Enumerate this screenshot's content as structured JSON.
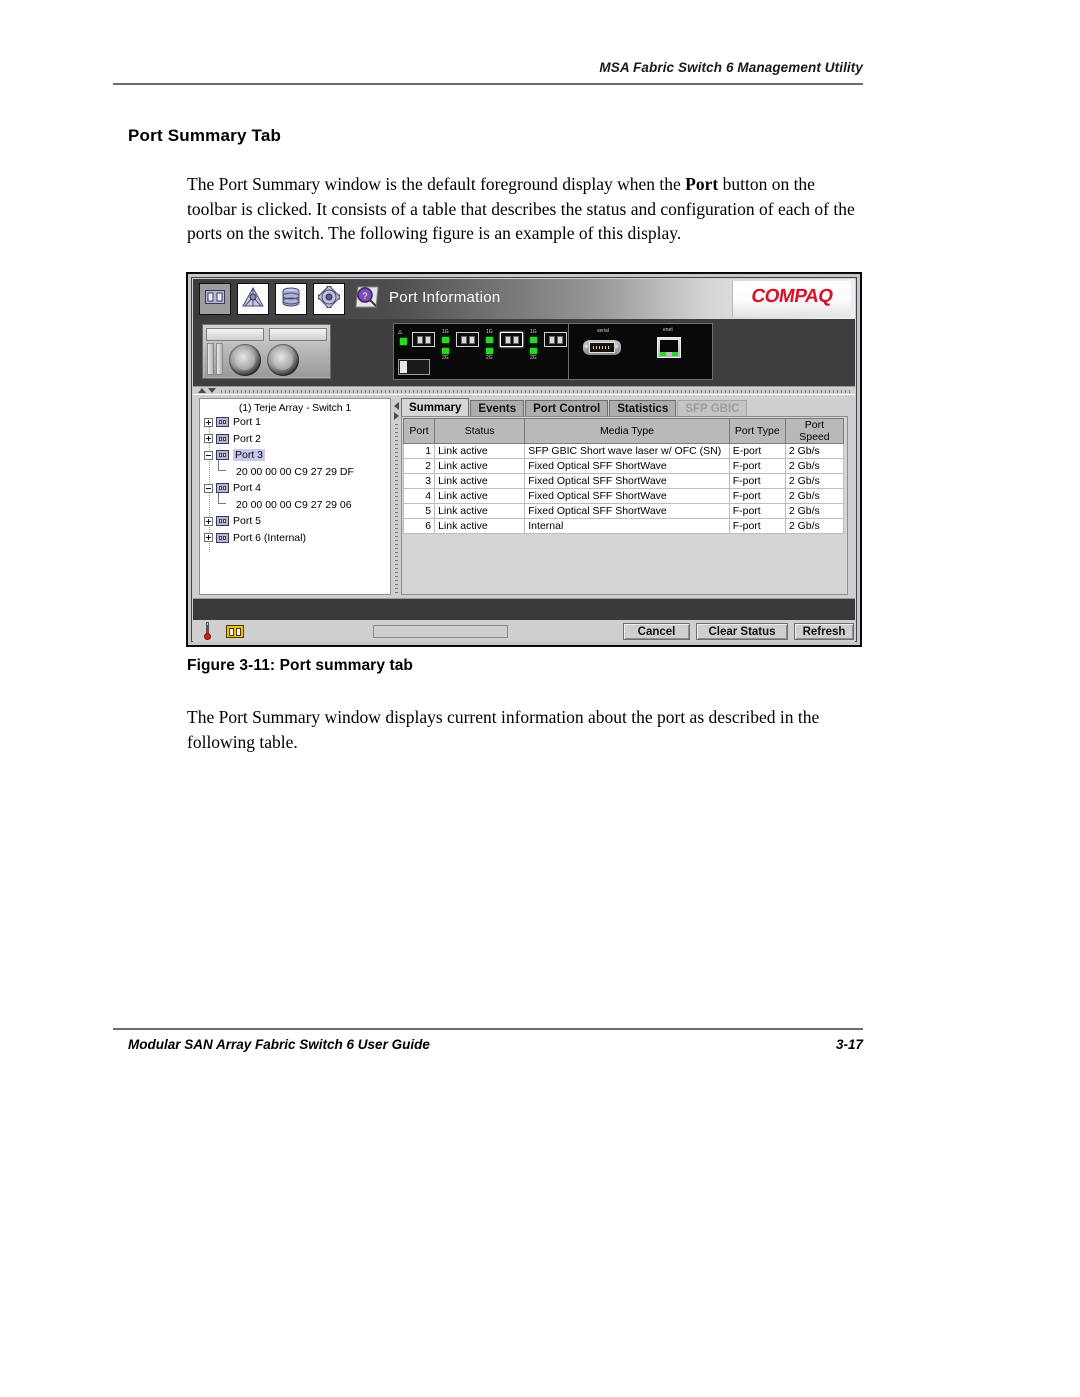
{
  "page": {
    "header": "MSA Fabric Switch 6 Management Utility",
    "section_title": "Port Summary Tab",
    "paragraph_1_a": "The Port Summary window is the default foreground display when the ",
    "paragraph_1_bold": "Port",
    "paragraph_1_b": " button on the toolbar is clicked. It consists of a table that describes the status and configuration of each of the ports on the switch. The following figure is an example of this display.",
    "figure_caption": "Figure 3-11:  Port summary tab",
    "paragraph_2": "The Port Summary window displays current information about the port as described in the following table.",
    "footer_left": "Modular SAN Array Fabric Switch 6 User Guide",
    "footer_right": "3-17"
  },
  "app": {
    "title": "Port Information",
    "brand": "COMPAQ",
    "toolbar_icons": [
      {
        "name": "ports-icon",
        "state": "active"
      },
      {
        "name": "fabric-topology-icon",
        "state": "normal"
      },
      {
        "name": "database-icon",
        "state": "normal"
      },
      {
        "name": "settings-gear-icon",
        "state": "normal"
      },
      {
        "name": "help-magnifier-icon",
        "state": "flat"
      }
    ],
    "faceplate": {
      "port_speed_top_label": "1G",
      "port_speed_bottom_label": "2G",
      "serial_label": "serial",
      "ethernet_label": "enet",
      "sfp_port_count": 5,
      "highlighted_sfp_index": 3
    },
    "tree": {
      "root": "(1) Terje Array - Switch 1",
      "nodes": [
        {
          "label": "Port 1",
          "toggle": "plus",
          "selected": false,
          "child": null
        },
        {
          "label": "Port 2",
          "toggle": "plus",
          "selected": false,
          "child": null
        },
        {
          "label": "Port 3",
          "toggle": "minus",
          "selected": true,
          "child": "20 00 00 00 C9 27 29 DF"
        },
        {
          "label": "Port 4",
          "toggle": "minus",
          "selected": false,
          "child": "20 00 00 00 C9 27 29 06"
        },
        {
          "label": "Port 5",
          "toggle": "plus",
          "selected": false,
          "child": null
        },
        {
          "label": "Port 6 (Internal)",
          "toggle": "plus",
          "selected": false,
          "child": null
        }
      ]
    },
    "tabs": [
      {
        "label": "Summary",
        "state": "selected"
      },
      {
        "label": "Events",
        "state": "normal"
      },
      {
        "label": "Port Control",
        "state": "normal"
      },
      {
        "label": "Statistics",
        "state": "normal"
      },
      {
        "label": "SFP GBIC",
        "state": "disabled"
      }
    ],
    "table": {
      "columns": [
        "Port",
        "Status",
        "Media Type",
        "Port Type",
        "Port Speed"
      ],
      "rows": [
        [
          "1",
          "Link active",
          "SFP GBIC Short wave laser w/ OFC (SN)",
          "E-port",
          "2 Gb/s"
        ],
        [
          "2",
          "Link active",
          "Fixed Optical SFF ShortWave",
          "F-port",
          "2 Gb/s"
        ],
        [
          "3",
          "Link active",
          "Fixed Optical SFF ShortWave",
          "F-port",
          "2 Gb/s"
        ],
        [
          "4",
          "Link active",
          "Fixed Optical SFF ShortWave",
          "F-port",
          "2 Gb/s"
        ],
        [
          "5",
          "Link active",
          "Fixed Optical SFF ShortWave",
          "F-port",
          "2 Gb/s"
        ],
        [
          "6",
          "Link active",
          "Internal",
          "F-port",
          "2 Gb/s"
        ]
      ]
    },
    "statusbar": {
      "temperature_icon": "thermometer-icon",
      "ports_icon": "ports-status-icon",
      "status_text": ""
    },
    "buttons": [
      {
        "label": "Cancel",
        "name": "cancel-button"
      },
      {
        "label": "Clear Status",
        "name": "clear-status-button"
      },
      {
        "label": "Refresh",
        "name": "refresh-button"
      }
    ]
  },
  "colors": {
    "brand_red": "#d8122a",
    "led_green": "#2bd52b",
    "selection_blue": "#c9c9f0",
    "toolbar_dark": "#3a3a3a"
  }
}
